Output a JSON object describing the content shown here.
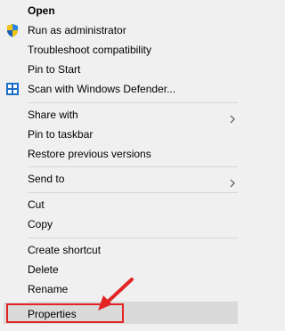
{
  "menu": {
    "items": [
      {
        "label": "Open",
        "bold": true
      },
      {
        "label": "Run as administrator",
        "icon": "uac-shield-icon"
      },
      {
        "label": "Troubleshoot compatibility"
      },
      {
        "label": "Pin to Start"
      },
      {
        "label": "Scan with Windows Defender...",
        "icon": "windows-defender-icon"
      },
      {
        "label": "Share with",
        "submenu": true
      },
      {
        "label": "Pin to taskbar"
      },
      {
        "label": "Restore previous versions"
      },
      {
        "label": "Send to",
        "submenu": true
      },
      {
        "label": "Cut"
      },
      {
        "label": "Copy"
      },
      {
        "label": "Create shortcut"
      },
      {
        "label": "Delete"
      },
      {
        "label": "Rename"
      },
      {
        "label": "Properties",
        "highlighted": true
      }
    ]
  },
  "annotation": {
    "highlight_color": "#e32424",
    "description_icon": "red-arrow-icon"
  }
}
